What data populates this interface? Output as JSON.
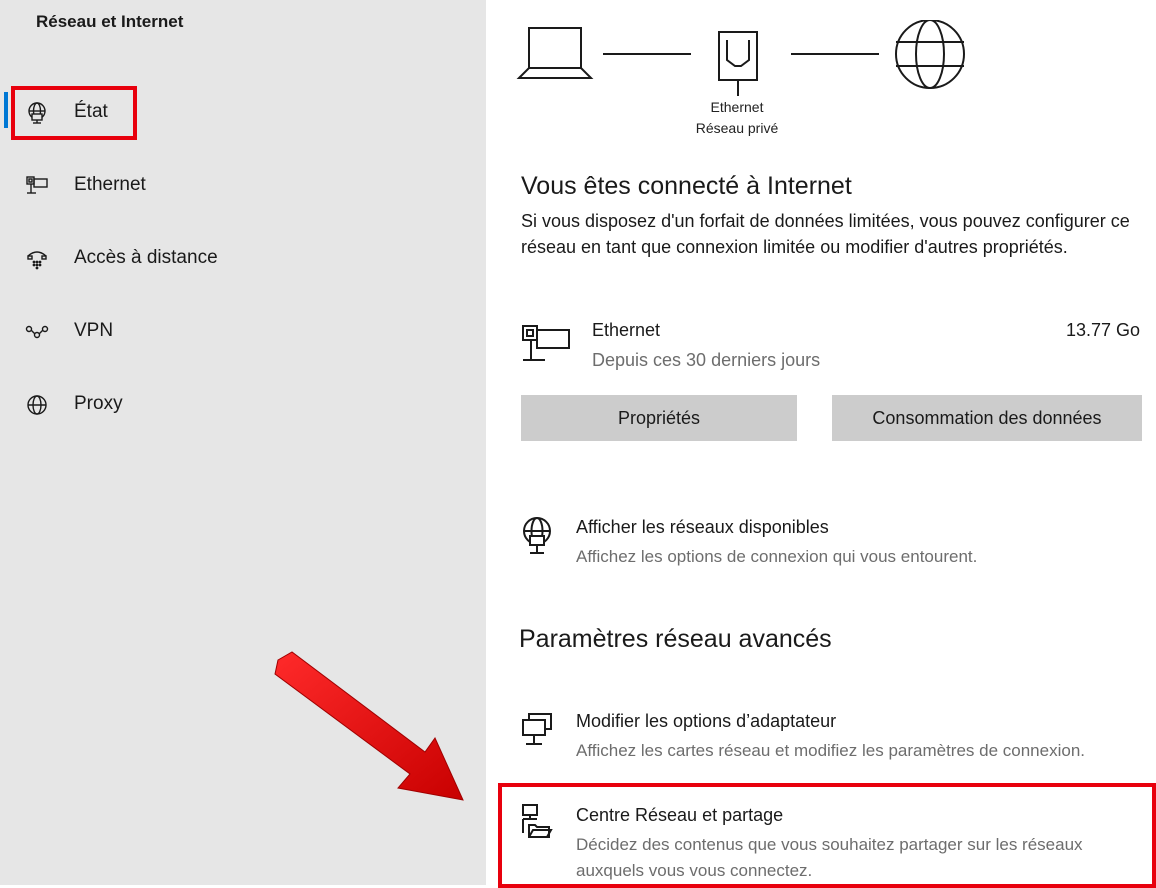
{
  "sidebar": {
    "title": "Réseau et Internet",
    "items": [
      {
        "label": "État",
        "icon": "globe-monitor-icon",
        "selected": true
      },
      {
        "label": "Ethernet",
        "icon": "ethernet-icon"
      },
      {
        "label": "Accès à distance",
        "icon": "dialup-icon"
      },
      {
        "label": "VPN",
        "icon": "vpn-icon"
      },
      {
        "label": "Proxy",
        "icon": "globe-icon"
      }
    ]
  },
  "topology": {
    "device_icon": "laptop-icon",
    "adapter_icon": "ethernet-port-icon",
    "internet_icon": "globe-icon",
    "adapter_name": "Ethernet",
    "network_profile": "Réseau privé"
  },
  "status": {
    "heading": "Vous êtes connecté à Internet",
    "description": "Si vous disposez d'un forfait de données limitées, vous pouvez configurer ce réseau en tant que connexion limitée ou modifier d'autres propriétés."
  },
  "connection": {
    "name": "Ethernet",
    "period": "Depuis ces 30 derniers jours",
    "usage": "13.77 Go",
    "properties_label": "Propriétés",
    "data_usage_label": "Consommation des données"
  },
  "show_networks": {
    "title": "Afficher les réseaux disponibles",
    "subtitle": "Affichez les options de connexion qui vous entourent."
  },
  "advanced": {
    "heading": "Paramètres réseau avancés",
    "adapter_options": {
      "title": "Modifier les options d’adaptateur",
      "subtitle": "Affichez les cartes réseau et modifiez les paramètres de connexion."
    },
    "sharing_center": {
      "title": "Centre Réseau et partage",
      "subtitle_line1": "Décidez des contenus que vous souhaitez partager sur les réseaux",
      "subtitle_line2": "auxquels vous vous connectez."
    }
  },
  "annotations": {
    "highlight_color": "#e8000d",
    "accent_color": "#0078d4"
  }
}
